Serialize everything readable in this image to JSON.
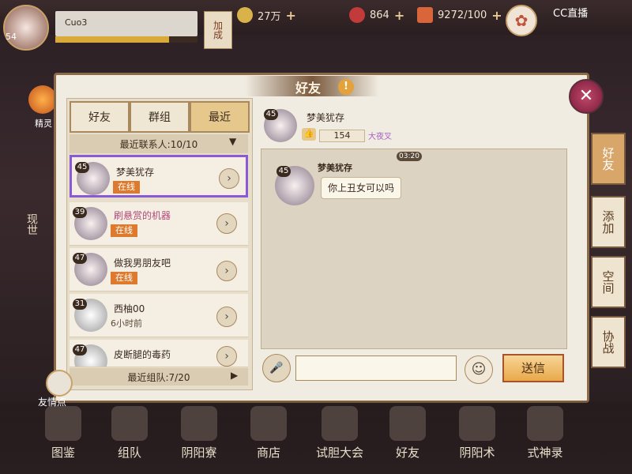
{
  "top": {
    "level": "54",
    "player_name": "Cuo3",
    "exp_progress": 0.8,
    "boost_label": "加成",
    "coin": "27万",
    "jade": "864",
    "stamina": "9272/100",
    "watermark": "CC直播"
  },
  "side": {
    "elf_label": "精灵",
    "side_text": "现世"
  },
  "panel": {
    "title": "好友",
    "warn_glyph": "!",
    "close_glyph": "✕"
  },
  "tabs": {
    "friends": "好友",
    "groups": "群组",
    "recent": "最近"
  },
  "recent_header": "最近联系人:10/10",
  "contacts": [
    {
      "level": "45",
      "name": "梦美犹存",
      "status": "在线"
    },
    {
      "level": "39",
      "name": "刷悬赏的机器",
      "status": "在线"
    },
    {
      "level": "47",
      "name": "做我男朋友吧",
      "status": "在线"
    },
    {
      "level": "31",
      "name": "西柚00",
      "status": "6小时前"
    },
    {
      "level": "47",
      "name": "皮断腿的毒药",
      "status": ""
    }
  ],
  "team_footer": "最近组队:7/20",
  "chat": {
    "level": "45",
    "name": "梦美犹存",
    "likes": "154",
    "guild": "大夜叉",
    "time": "03:20",
    "sender": "梦美犹存",
    "message": "你上丑女可以吗",
    "input_placeholder": "",
    "send_label": "送信"
  },
  "right_tabs": {
    "friends": "好友",
    "add": "添加",
    "space": "空间",
    "coop": "协战"
  },
  "bond_label": "友情点",
  "nav": [
    "图鉴",
    "组队",
    "阴阳寮",
    "商店",
    "试胆大会",
    "好友",
    "阴阳术",
    "式神录"
  ],
  "colors": {
    "accent": "#e9a94a",
    "online": "#dd7a2e",
    "selected": "#8a5ad6"
  }
}
